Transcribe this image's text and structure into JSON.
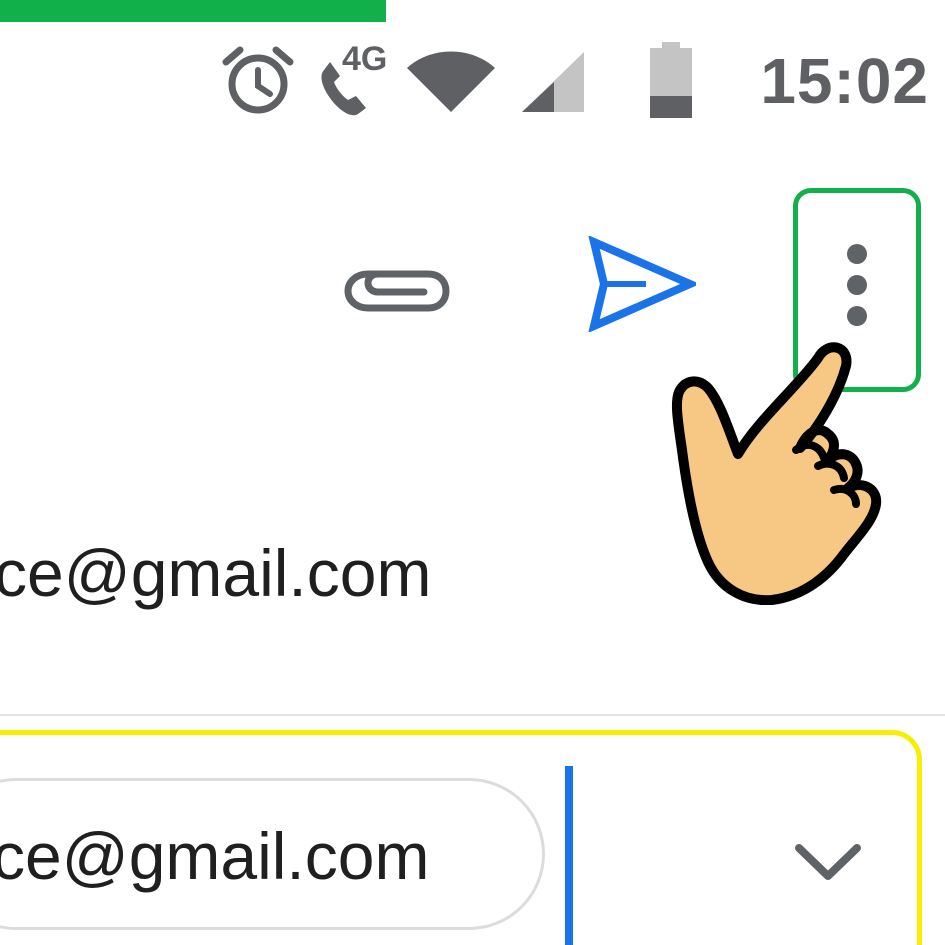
{
  "status_bar": {
    "time": "15:02",
    "network_label": "4G",
    "icons": [
      "alarm-icon",
      "volte-call-icon",
      "wifi-icon",
      "cell-signal-icon",
      "battery-icon"
    ]
  },
  "toolbar": {
    "icons": [
      "attach-icon",
      "send-icon",
      "more-vert-icon"
    ],
    "send_color": "#1a73e8",
    "icon_color": "#5f6368"
  },
  "compose": {
    "from_value": "ce@gmail.com",
    "to_chip_value": "ce@gmail.com"
  },
  "annotations": {
    "progress_color": "#12b04a",
    "menu_highlight_color": "#12b04a",
    "to_highlight_color": "#f6ef00",
    "pointer": "hand-pointer-icon"
  }
}
